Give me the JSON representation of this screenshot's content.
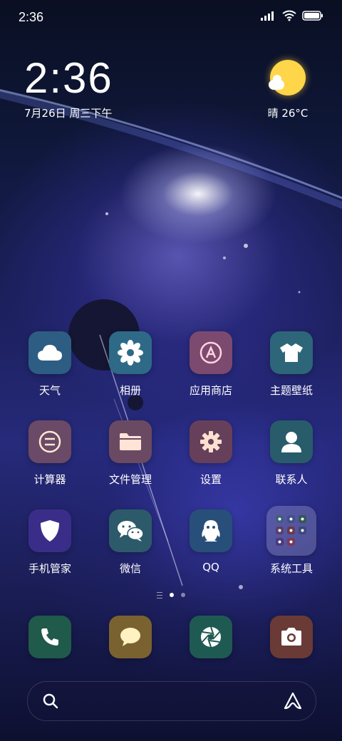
{
  "status_bar": {
    "time": "2:36"
  },
  "clock_widget": {
    "time": "2:36",
    "date": "7月26日 周三下午"
  },
  "weather_widget": {
    "text": "晴 26°C",
    "icon": "sun-cloud-icon"
  },
  "apps": [
    [
      {
        "label": "天气",
        "icon": "cloud-icon",
        "bg": "#2e5d84"
      },
      {
        "label": "相册",
        "icon": "flower-icon",
        "bg": "#2e6a88"
      },
      {
        "label": "应用商店",
        "icon": "app-store-icon",
        "bg": "#7c4a6e"
      },
      {
        "label": "主题壁纸",
        "icon": "tshirt-icon",
        "bg": "#2d6679"
      }
    ],
    [
      {
        "label": "计算器",
        "icon": "calculator-icon",
        "bg": "#6a4a66"
      },
      {
        "label": "文件管理",
        "icon": "folder-icon",
        "bg": "#6a4a62"
      },
      {
        "label": "设置",
        "icon": "gear-icon",
        "bg": "#66405a"
      },
      {
        "label": "联系人",
        "icon": "contact-icon",
        "bg": "#285c6a"
      }
    ],
    [
      {
        "label": "手机管家",
        "icon": "shield-icon",
        "bg": "#3a2d8a"
      },
      {
        "label": "微信",
        "icon": "wechat-icon",
        "bg": "#2d5a6a"
      },
      {
        "label": "QQ",
        "icon": "qq-icon",
        "bg": "#284f7a"
      },
      {
        "label": "系统工具",
        "icon": "folder-grid-icon",
        "bg": "rgba(190,190,220,0.28)"
      }
    ]
  ],
  "dock": [
    {
      "name": "phone",
      "icon": "phone-icon",
      "bg": "#1f5a4a"
    },
    {
      "name": "messages",
      "icon": "message-icon",
      "bg": "#7a6230"
    },
    {
      "name": "browser",
      "icon": "aperture-icon",
      "bg": "#1f5a52"
    },
    {
      "name": "camera",
      "icon": "camera-icon",
      "bg": "#6a3a36"
    }
  ],
  "page_indicator": {
    "pages": 2,
    "active": 0
  },
  "search": {
    "icon": "search-icon",
    "assistant_icon": "assistant-icon"
  }
}
